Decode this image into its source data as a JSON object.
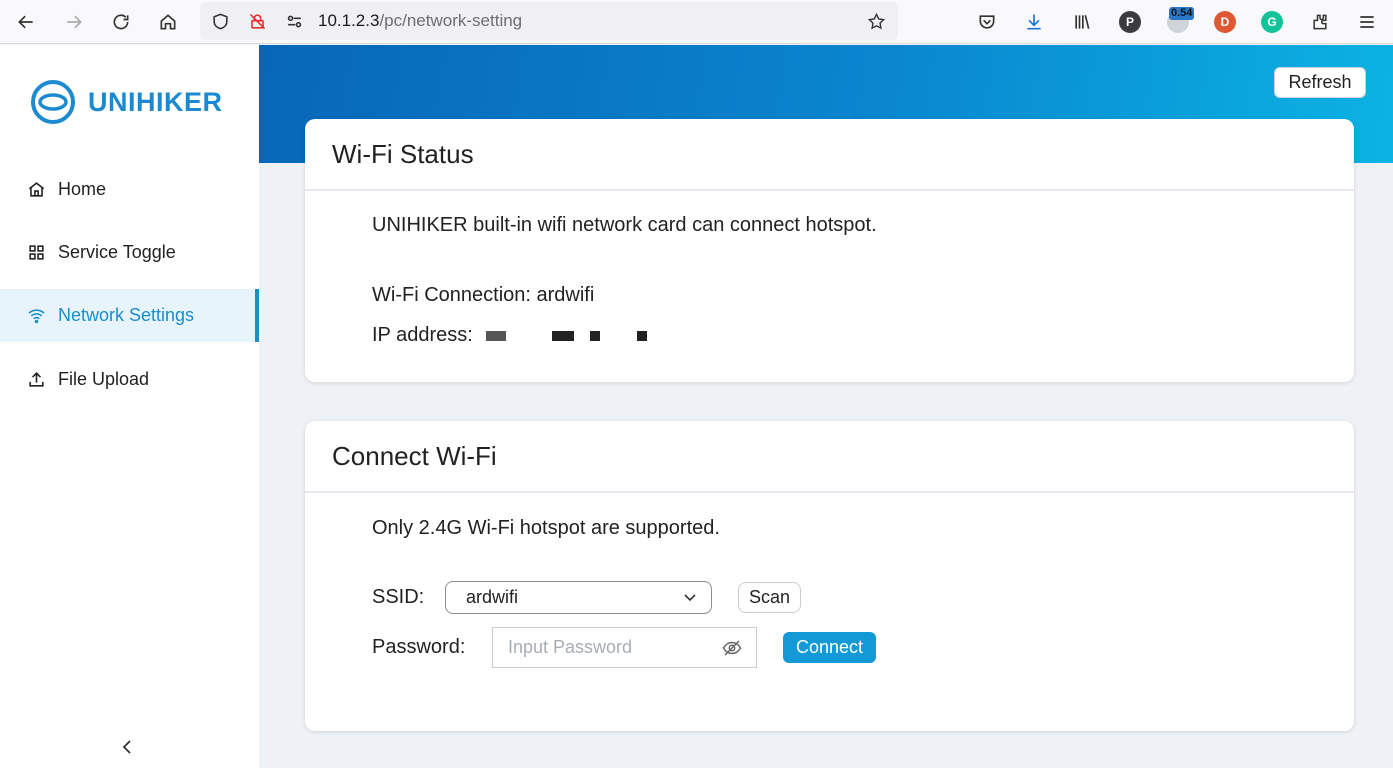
{
  "browser": {
    "url_host": "10.1.2.3",
    "url_path": "/pc/network-setting",
    "extension_badge": "0.54",
    "extension_p_letter": "P",
    "extension_g_letter": "G"
  },
  "sidebar": {
    "logo_text": "UNIHIKER",
    "items": [
      {
        "label": "Home",
        "icon": "home-icon"
      },
      {
        "label": "Service Toggle",
        "icon": "grid-icon"
      },
      {
        "label": "Network Settings",
        "icon": "wifi-icon"
      },
      {
        "label": "File Upload",
        "icon": "upload-icon"
      }
    ],
    "collapse_glyph": "<"
  },
  "header": {
    "refresh_label": "Refresh"
  },
  "wifi_status": {
    "title": "Wi-Fi Status",
    "description": "UNIHIKER built-in wifi network card can connect hotspot.",
    "connection_text": "Wi-Fi Connection: ardwifi",
    "ip_label": "IP address:"
  },
  "connect_wifi": {
    "title": "Connect Wi-Fi",
    "note": "Only 2.4G Wi-Fi hotspot are supported.",
    "ssid_label": "SSID:",
    "ssid_value": "ardwifi",
    "scan_label": "Scan",
    "password_label": "Password:",
    "password_placeholder": "Input Password",
    "connect_label": "Connect"
  },
  "colors": {
    "accent": "#1a8dcc",
    "connect_button": "#139ad6",
    "banner_start": "#0866b8",
    "banner_end": "#0bb3e3"
  }
}
